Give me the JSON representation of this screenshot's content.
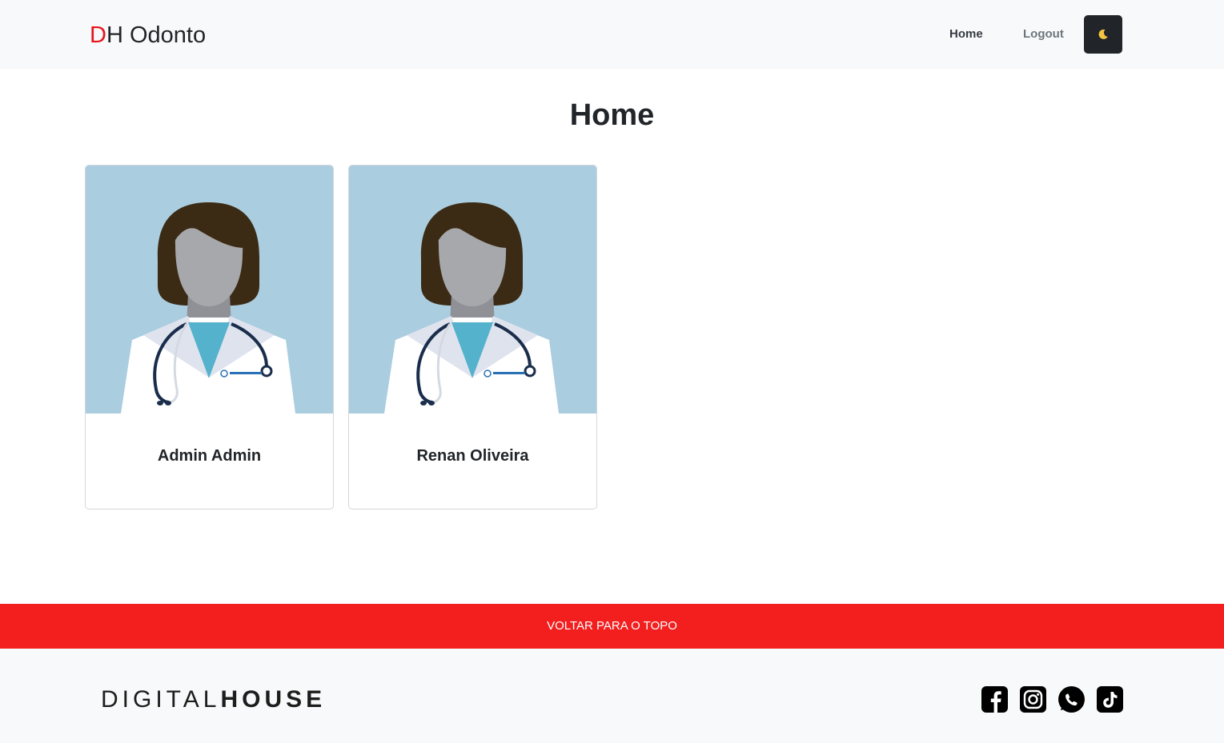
{
  "navbar": {
    "brand_initial": "D",
    "brand_rest": "H Odonto",
    "links": [
      {
        "label": "Home"
      },
      {
        "label": "Logout"
      }
    ],
    "theme_toggle_icon": "moon-icon"
  },
  "main": {
    "title": "Home",
    "cards": [
      {
        "name": "Admin Admin",
        "image_icon": "doctor-avatar-icon"
      },
      {
        "name": "Renan Oliveira",
        "image_icon": "doctor-avatar-icon"
      }
    ]
  },
  "back_to_top": {
    "label": "VOLTAR PARA O TOPO"
  },
  "footer": {
    "logo_light": "DIGITAL",
    "logo_heavy": "HOUSE",
    "social": [
      "facebook-icon",
      "instagram-icon",
      "whatsapp-icon",
      "tiktok-icon"
    ]
  },
  "colors": {
    "accent_red": "#f31f1f",
    "brand_red": "#e6131b",
    "navbar_bg": "#f8f9fa",
    "card_image_bg": "#aacddf",
    "dark_button": "#212529"
  }
}
